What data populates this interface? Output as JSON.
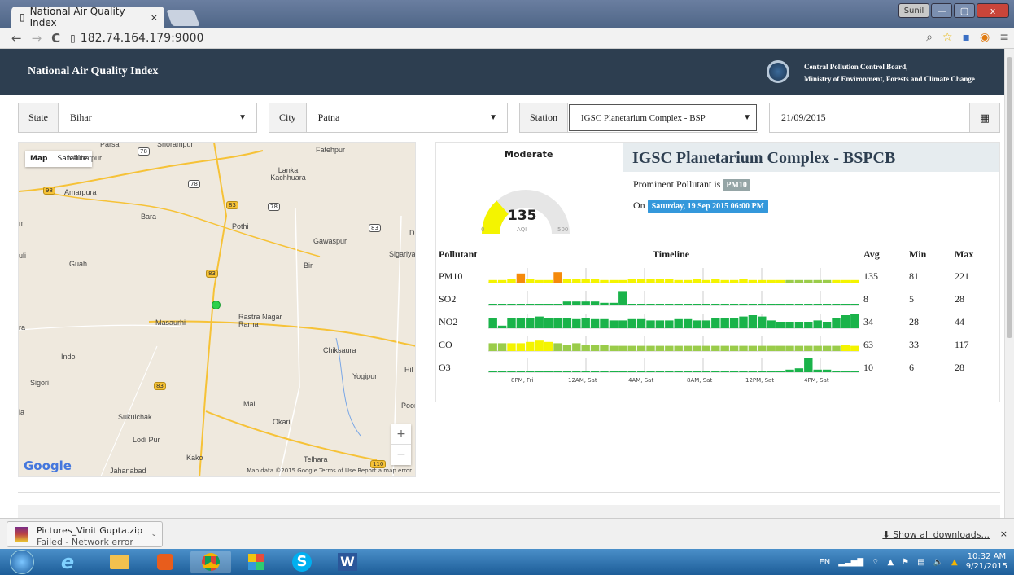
{
  "browser": {
    "tab_title": "National Air Quality Index",
    "tab_close": "×",
    "url": "182.74.164.179:9000",
    "user": "Sunil",
    "win_min": "—",
    "win_max": "▢",
    "win_close": "x"
  },
  "header": {
    "title": "National Air Quality Index",
    "org_line1": "Central Pollution Control Board,",
    "org_line2": "Ministry of Environment, Forests and Climate Change"
  },
  "filters": {
    "state_label": "State",
    "state_value": "Bihar",
    "city_label": "City",
    "city_value": "Patna",
    "station_label": "Station",
    "station_value": "IGSC Planetarium Complex - BSP",
    "date_value": "21/09/2015"
  },
  "map": {
    "type_map": "Map",
    "type_satellite": "Satellite",
    "footer": "Map data ©2015 Google   Terms of Use   Report a map error",
    "google": "Google",
    "zoom_in": "+",
    "zoom_out": "−",
    "places": [
      "Parsa",
      "Shorampur",
      "Naubatpur",
      "Fatehpur",
      "Lanka Kachhuara",
      "Amarpura",
      "Bara",
      "Pothi",
      "Gawaspur",
      "Sigariya",
      "Guah",
      "Bir",
      "Masaurhi",
      "Rastra Nagar Rarha",
      "Chiksaura",
      "Indo",
      "Yogipur",
      "Sigori",
      "Mai",
      "Sukulchak",
      "Okari",
      "Lodi Pur",
      "Kako",
      "Telhara",
      "Jahanabad",
      "Hil",
      "Poon",
      "D",
      "uli",
      "ra",
      "la",
      "m"
    ],
    "shields": [
      "78",
      "78",
      "78",
      "98",
      "83",
      "83",
      "83",
      "83",
      "110"
    ]
  },
  "aqi": {
    "category": "Moderate",
    "value": "135",
    "label": "AQI",
    "min": "0",
    "max": "500",
    "level": 0.27,
    "color": "#f4f400"
  },
  "station": {
    "name": "IGSC Planetarium Complex - BSPCB",
    "prominent_prefix": "Prominent Pollutant is",
    "prominent": "PM10",
    "on_prefix": "On",
    "datetime": "Saturday, 19 Sep 2015 06:00 PM"
  },
  "table": {
    "headers": {
      "pollutant": "Pollutant",
      "timeline": "Timeline",
      "avg": "Avg",
      "min": "Min",
      "max": "Max"
    },
    "rows": [
      {
        "name": "PM10",
        "avg": "135",
        "min": "81",
        "max": "221"
      },
      {
        "name": "SO2",
        "avg": "8",
        "min": "5",
        "max": "28"
      },
      {
        "name": "NO2",
        "avg": "34",
        "min": "28",
        "max": "44"
      },
      {
        "name": "CO",
        "avg": "63",
        "min": "33",
        "max": "117"
      },
      {
        "name": "O3",
        "avg": "10",
        "min": "6",
        "max": "28"
      }
    ],
    "ticks": [
      "8PM, Fri",
      "12AM, Sat",
      "4AM, Sat",
      "8AM, Sat",
      "12PM, Sat",
      "4PM, Sat"
    ]
  },
  "timeline": {
    "colors": {
      "good": "#1ab34a",
      "satisfactory": "#9acc4a",
      "moderate": "#f4f400",
      "poor": "#f58a0b"
    },
    "series": [
      {
        "bars": [
          2,
          2,
          3,
          7,
          3,
          2,
          2,
          8,
          3,
          3,
          3,
          3,
          2,
          2,
          2,
          3,
          3,
          3,
          3,
          3,
          2,
          2,
          3,
          2,
          3,
          2,
          2,
          3,
          2,
          2,
          2,
          2,
          2,
          2,
          2,
          2,
          2,
          2,
          2,
          2
        ],
        "cls": [
          "m",
          "m",
          "m",
          "p",
          "m",
          "m",
          "m",
          "p",
          "m",
          "m",
          "m",
          "m",
          "m",
          "m",
          "m",
          "m",
          "m",
          "m",
          "m",
          "m",
          "m",
          "m",
          "m",
          "m",
          "m",
          "m",
          "m",
          "m",
          "m",
          "m",
          "m",
          "m",
          "s",
          "s",
          "s",
          "s",
          "s",
          "m",
          "m",
          "m"
        ]
      },
      {
        "bars": [
          1,
          1,
          1,
          1,
          1,
          1,
          1,
          1,
          3,
          3,
          3,
          3,
          2,
          2,
          11,
          1,
          1,
          1,
          1,
          1,
          1,
          1,
          1,
          1,
          1,
          1,
          1,
          1,
          1,
          1,
          1,
          1,
          1,
          1,
          1,
          1,
          1,
          1,
          1,
          1
        ],
        "cls": [
          "g"
        ]
      },
      {
        "bars": [
          8,
          2,
          8,
          8,
          8,
          9,
          8,
          8,
          8,
          7,
          8,
          7,
          7,
          6,
          6,
          7,
          7,
          6,
          6,
          6,
          7,
          7,
          6,
          6,
          8,
          8,
          8,
          9,
          10,
          9,
          6,
          5,
          5,
          5,
          5,
          6,
          5,
          8,
          10,
          11
        ],
        "cls": [
          "g"
        ]
      },
      {
        "bars": [
          6,
          6,
          6,
          6,
          7,
          8,
          7,
          6,
          5,
          6,
          5,
          5,
          5,
          4,
          4,
          4,
          4,
          4,
          4,
          4,
          4,
          4,
          4,
          4,
          4,
          4,
          4,
          4,
          4,
          4,
          4,
          4,
          4,
          4,
          4,
          4,
          4,
          4,
          5,
          4
        ],
        "cls": [
          "s",
          "s",
          "m",
          "m",
          "m",
          "m",
          "m",
          "s",
          "s",
          "s",
          "s",
          "s",
          "s",
          "s",
          "s",
          "s",
          "s",
          "s",
          "s",
          "s",
          "s",
          "s",
          "s",
          "s",
          "s",
          "s",
          "s",
          "s",
          "s",
          "s",
          "s",
          "s",
          "s",
          "s",
          "s",
          "s",
          "s",
          "s",
          "m",
          "m"
        ]
      },
      {
        "bars": [
          1,
          1,
          1,
          1,
          1,
          1,
          1,
          1,
          1,
          1,
          1,
          1,
          1,
          1,
          1,
          1,
          1,
          1,
          1,
          1,
          1,
          1,
          1,
          1,
          1,
          1,
          1,
          1,
          1,
          1,
          1,
          1,
          2,
          3,
          11,
          2,
          2,
          1,
          1,
          1
        ],
        "cls": [
          "g"
        ]
      }
    ]
  },
  "downloads": {
    "file": "Pictures_Vinit Gupta.zip",
    "status": "Failed - Network error",
    "show_all": "Show all downloads...",
    "close": "×"
  },
  "tray": {
    "lang": "EN",
    "time": "10:32 AM",
    "date": "9/21/2015"
  }
}
